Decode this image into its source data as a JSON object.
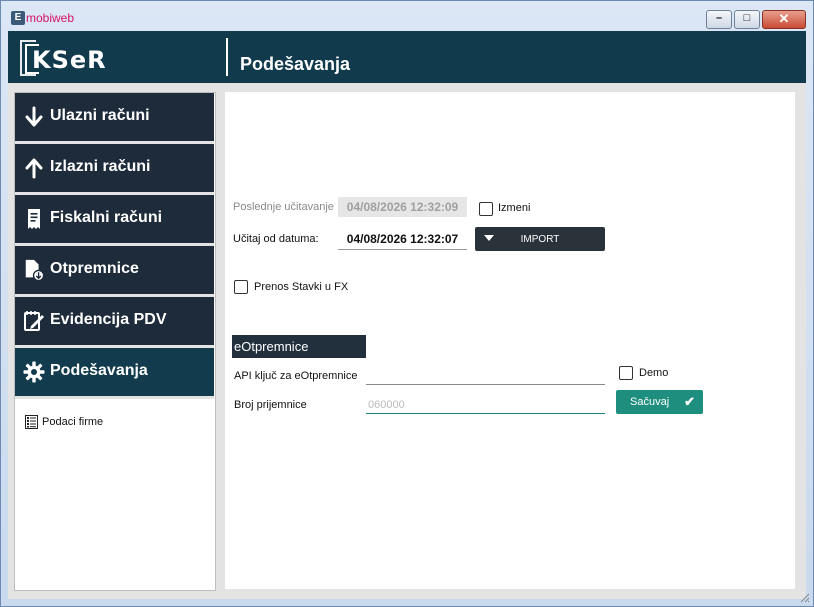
{
  "window": {
    "app_name": "mobiweb",
    "app_icon_letter": "E"
  },
  "header": {
    "logo_text": "KSeR",
    "title": "Podešavanja"
  },
  "sidebar": {
    "items": [
      {
        "label": "Ulazni računi",
        "icon": "arrow-down-icon"
      },
      {
        "label": "Izlazni računi",
        "icon": "arrow-up-icon"
      },
      {
        "label": "Fiskalni računi",
        "icon": "receipt-icon"
      },
      {
        "label": "Otpremnice",
        "icon": "document-download-icon"
      },
      {
        "label": "Evidencija PDV",
        "icon": "notepad-edit-icon"
      },
      {
        "label": "Podešavanja",
        "icon": "gear-icon"
      }
    ],
    "active_index": 5,
    "sub_items": [
      {
        "label": "Podaci firme",
        "icon": "company-data-icon"
      }
    ]
  },
  "form": {
    "last_load_label": "Poslednje učitavanje",
    "last_load_value": "04/08/2026 12:32:09",
    "izmeni_label": "Izmeni",
    "izmeni_checked": false,
    "load_from_label": "Učitaj od datuma:",
    "load_from_value": "04/08/2026 12:32:07",
    "import_label": "IMPORT",
    "prenos_label": "Prenos Stavki u FX",
    "prenos_checked": false
  },
  "eotpremnice": {
    "title": "eOtpremnice",
    "api_label": "API ključ za eOtpremnice",
    "api_value": "",
    "demo_label": "Demo",
    "demo_checked": false,
    "broj_label": "Broj prijemnice",
    "broj_placeholder": "060000",
    "save_label": "Sačuvaj"
  },
  "colors": {
    "header": "#113a4c",
    "nav": "#1e2b3a",
    "accent": "#1e8f7f",
    "app_title": "#d41367"
  }
}
